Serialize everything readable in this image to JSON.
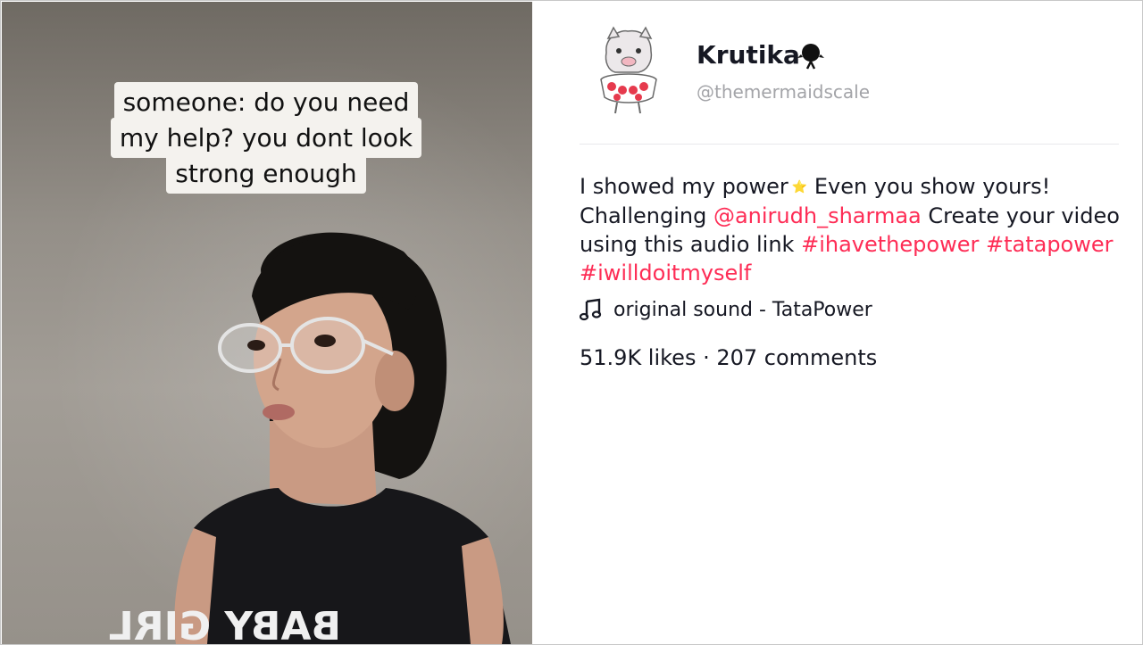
{
  "video": {
    "caption_lines": [
      "someone: do you need",
      "my help? you dont look",
      "strong enough"
    ],
    "shirt_text": "BABY GIRL"
  },
  "author": {
    "display_name": "Krutika",
    "handle": "@themermaidscale",
    "badge_icon": "bird-icon",
    "avatar_icon": "cartoon-boar-avatar"
  },
  "description": {
    "text_1": "I showed my power",
    "star": "⭐",
    "text_2": " Even you show yours! Challenging ",
    "mention": "@anirudh_sharmaa",
    "text_3": " Create your video using this audio link ",
    "hashtags": [
      "#ihavethepower",
      "#tatapower",
      "#iwilldoitmyself"
    ]
  },
  "sound": {
    "icon": "music-note-icon",
    "label": "original sound - TataPower"
  },
  "stats": {
    "likes": "51.9K likes",
    "separator": " · ",
    "comments": "207 comments"
  },
  "colors": {
    "accent": "#fe2c55",
    "text": "#161823",
    "muted": "#a3a4a8"
  }
}
